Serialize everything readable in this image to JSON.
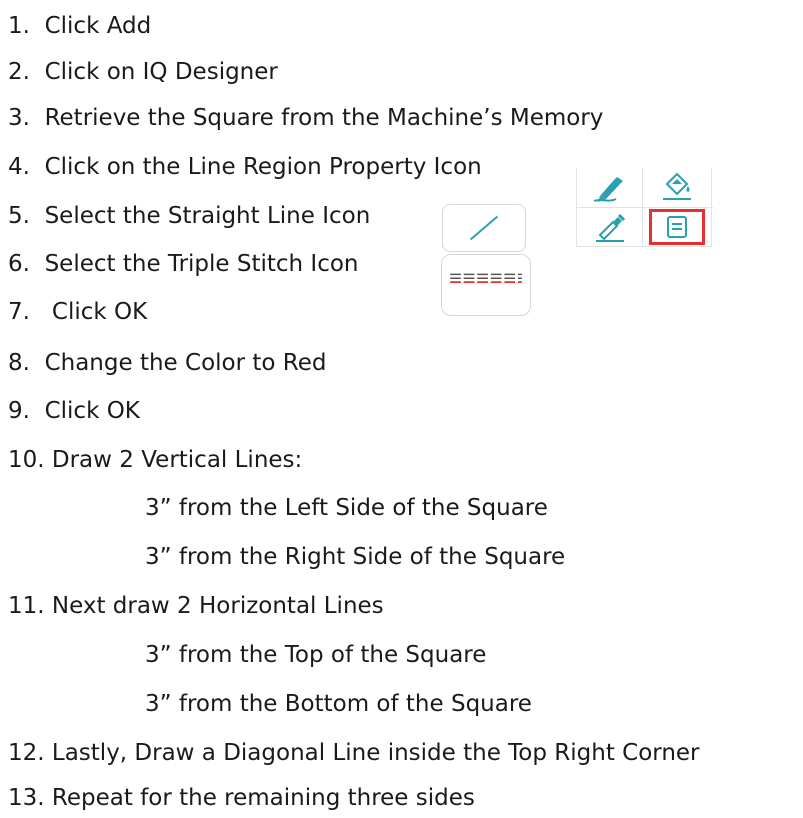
{
  "steps": [
    {
      "num": "1.",
      "text": "Click Add"
    },
    {
      "num": "2.",
      "text": "Click on IQ Designer"
    },
    {
      "num": "3.",
      "text": "Retrieve the Square from the Machine’s Memory"
    },
    {
      "num": "4.",
      "text": "Click on the Line Region Property Icon"
    },
    {
      "num": "5.",
      "text": "Select the Straight Line Icon"
    },
    {
      "num": "6.",
      "text": "Select the Triple Stitch Icon"
    },
    {
      "num": "7.",
      "text": " Click OK"
    },
    {
      "num": "8.",
      "text": "Change the Color to Red"
    },
    {
      "num": "9.",
      "text": "Click OK"
    },
    {
      "num": "10.",
      "text": "Draw 2 Vertical Lines:"
    },
    {
      "num": "",
      "text": "3” from the Left Side of the Square"
    },
    {
      "num": "",
      "text": "3” from the Right Side of the Square"
    },
    {
      "num": "11.",
      "text": "Next draw 2 Horizontal Lines"
    },
    {
      "num": "",
      "text": "3” from the Top of the Square"
    },
    {
      "num": "",
      "text": "3” from the Bottom of the Square"
    },
    {
      "num": "12.",
      "text": "Lastly, Draw a Diagonal Line inside the Top Right Corner"
    },
    {
      "num": "13.",
      "text": "Repeat for the remaining three sides"
    }
  ],
  "icons": {
    "pen": "pen-icon",
    "fill": "fill-icon",
    "dropper": "dropper-icon",
    "region": "region-property-icon",
    "straight_line": "straight-line-icon",
    "triple_stitch": "triple-stitch-icon"
  },
  "colors": {
    "icon_teal": "#2a9fb0",
    "highlight_red": "#e5302f",
    "stitch_dark": "#555555",
    "stitch_red": "#e5302f"
  }
}
